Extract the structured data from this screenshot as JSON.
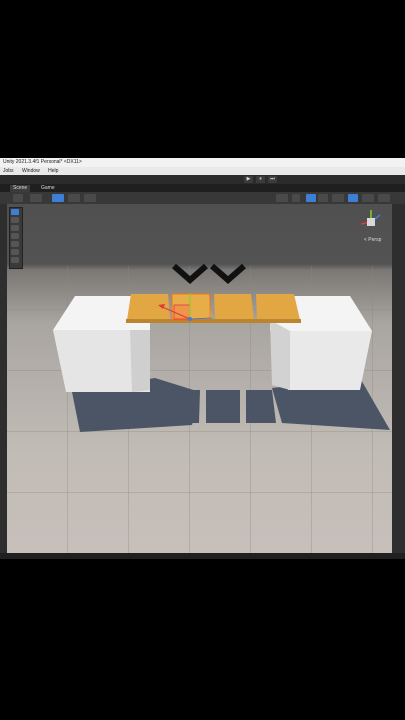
{
  "window": {
    "title": "Unity 2021.3.4f1 Personal* <DX11>"
  },
  "menu": {
    "items": [
      "Jobs",
      "Window",
      "Help"
    ]
  },
  "playbar": {
    "play": "▶",
    "pause": "⏸",
    "step": "⏭"
  },
  "tabs": [
    {
      "label": "Scene"
    },
    {
      "label": "Game"
    }
  ],
  "scene_view": {
    "projection_label": "< Persp"
  },
  "colors": {
    "plank": "#e2a643",
    "box": "#f1f1f1",
    "shadow": "#4b5566",
    "floor": "#c3bdb7",
    "horizon": "#525252",
    "selection": "#3d7fd6"
  }
}
